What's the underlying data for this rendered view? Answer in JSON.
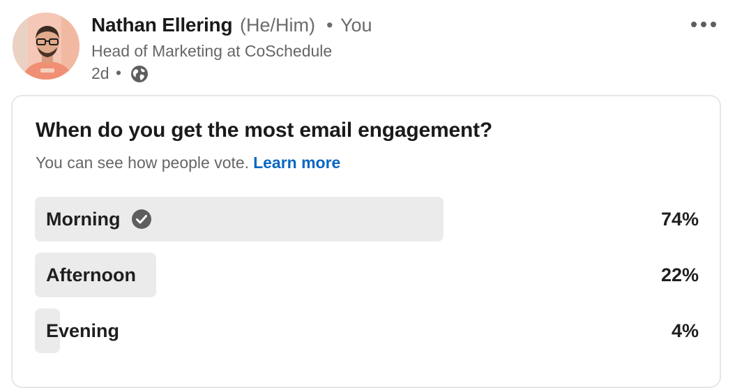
{
  "author": {
    "name": "Nathan Ellering",
    "pronouns": "(He/Him)",
    "separator": "•",
    "relation": "You",
    "headline": "Head of Marketing at CoSchedule",
    "time": "2d",
    "visibility_icon": "globe-icon",
    "avatar_icon": "profile-photo"
  },
  "menu": {
    "icon": "more-horizontal-icon"
  },
  "poll": {
    "question": "When do you get the most email engagement?",
    "note": "You can see how people vote.",
    "learn_more": "Learn more",
    "options": [
      {
        "label": "Morning",
        "percent_text": "74%",
        "share": 0.74,
        "voted": true
      },
      {
        "label": "Afternoon",
        "percent_text": "22%",
        "share": 0.22,
        "voted": false
      },
      {
        "label": "Evening",
        "percent_text": "4%",
        "share": 0.04,
        "voted": false
      }
    ],
    "voted_icon": "check-circle-icon"
  },
  "colors": {
    "link": "#0a66c2",
    "bar": "#ebebeb",
    "muted_text": "#666666"
  }
}
